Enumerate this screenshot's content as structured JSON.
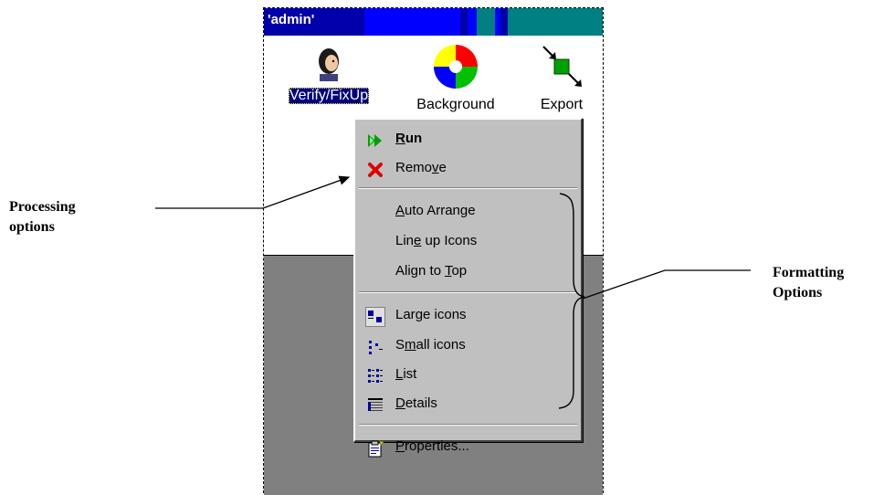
{
  "window": {
    "title": "'admin'",
    "title_colors": [
      "#0000aa",
      "#0000ff",
      "#008080"
    ]
  },
  "desktop_icons": [
    {
      "label": "Verify/FixUp",
      "icon": "person-head-icon",
      "selected": true
    },
    {
      "label": "Background",
      "icon": "color-wheel-icon",
      "selected": false
    },
    {
      "label": "Export",
      "icon": "export-arrows-icon",
      "selected": false
    }
  ],
  "context_menu": {
    "processing": [
      {
        "label": "Run",
        "mnemonic": "R",
        "icon": "run-icon",
        "bold": true
      },
      {
        "label": "Remove",
        "mnemonic": "v",
        "icon": "remove-x-icon"
      }
    ],
    "arrange": [
      {
        "label": "Auto Arrange",
        "mnemonic": "A"
      },
      {
        "label": "Line up Icons",
        "mnemonic": "e"
      },
      {
        "label": "Align to Top",
        "mnemonic": "T"
      }
    ],
    "view": [
      {
        "label": "Large icons",
        "mnemonic": "g",
        "icon": "large-icons-icon",
        "checked": true
      },
      {
        "label": "Small icons",
        "mnemonic": "m",
        "icon": "small-icons-icon"
      },
      {
        "label": "List",
        "mnemonic": "L",
        "icon": "list-view-icon"
      },
      {
        "label": "Details",
        "mnemonic": "D",
        "icon": "details-view-icon"
      }
    ],
    "properties": {
      "label": "Properties...",
      "mnemonic": "P",
      "icon": "properties-icon"
    }
  },
  "annotations": {
    "processing_line1": "Processing",
    "processing_line2": "options",
    "formatting_line1": "Formatting",
    "formatting_line2": "Options"
  },
  "colors": {
    "menu_bg": "#c0c0c0",
    "selection": "#000080",
    "workspace": "#808080",
    "run_green": "#00a000",
    "remove_red": "#e00000"
  }
}
